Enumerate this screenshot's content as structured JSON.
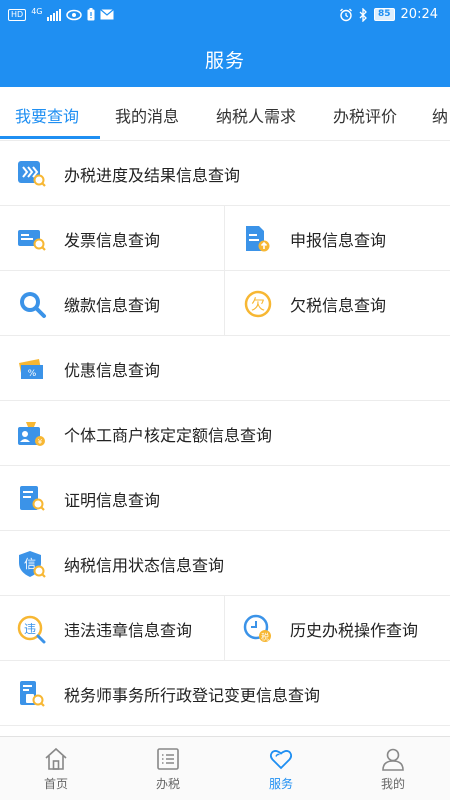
{
  "status_bar": {
    "network_badge": "HD",
    "network_type": "4G",
    "battery": "85",
    "time": "20:24"
  },
  "header": {
    "title": "服务"
  },
  "tabs": [
    {
      "label": "我要查询",
      "active": true
    },
    {
      "label": "我的消息",
      "active": false
    },
    {
      "label": "纳税人需求",
      "active": false
    },
    {
      "label": "办税评价",
      "active": false
    },
    {
      "label": "纳",
      "active": false
    }
  ],
  "menu": {
    "progress": {
      "label": "办税进度及结果信息查询",
      "icon": "double-chevron-search-icon"
    },
    "invoice": {
      "label": "发票信息查询",
      "icon": "invoice-search-icon"
    },
    "declare": {
      "label": "申报信息查询",
      "icon": "document-upload-icon"
    },
    "payment": {
      "label": "缴款信息查询",
      "icon": "magnifier-icon"
    },
    "arrears": {
      "label": "欠税信息查询",
      "icon": "owe-tax-icon"
    },
    "preferential": {
      "label": "优惠信息查询",
      "icon": "discount-ticket-icon"
    },
    "individual": {
      "label": "个体工商户核定定额信息查询",
      "icon": "quota-card-icon"
    },
    "certificate": {
      "label": "证明信息查询",
      "icon": "certificate-search-icon"
    },
    "credit": {
      "label": "纳税信用状态信息查询",
      "icon": "credit-shield-icon"
    },
    "violation": {
      "label": "违法违章信息查询",
      "icon": "violation-search-icon"
    },
    "history": {
      "label": "历史办税操作查询",
      "icon": "clock-tax-icon"
    },
    "agency": {
      "label": "税务师事务所行政登记变更信息查询",
      "icon": "agency-search-icon"
    }
  },
  "icon_glyphs": {
    "arrears": "欠",
    "credit": "信",
    "violation": "违",
    "history": "税"
  },
  "bottom_nav": [
    {
      "label": "首页",
      "icon": "home-icon",
      "active": false
    },
    {
      "label": "办税",
      "icon": "list-icon",
      "active": false
    },
    {
      "label": "服务",
      "icon": "heart-icon",
      "active": true
    },
    {
      "label": "我的",
      "icon": "person-icon",
      "active": false
    }
  ],
  "colors": {
    "primary": "#1f8ff2",
    "icon_blue": "#3b93e8",
    "icon_yellow": "#f7b733",
    "divider": "#ececec"
  }
}
